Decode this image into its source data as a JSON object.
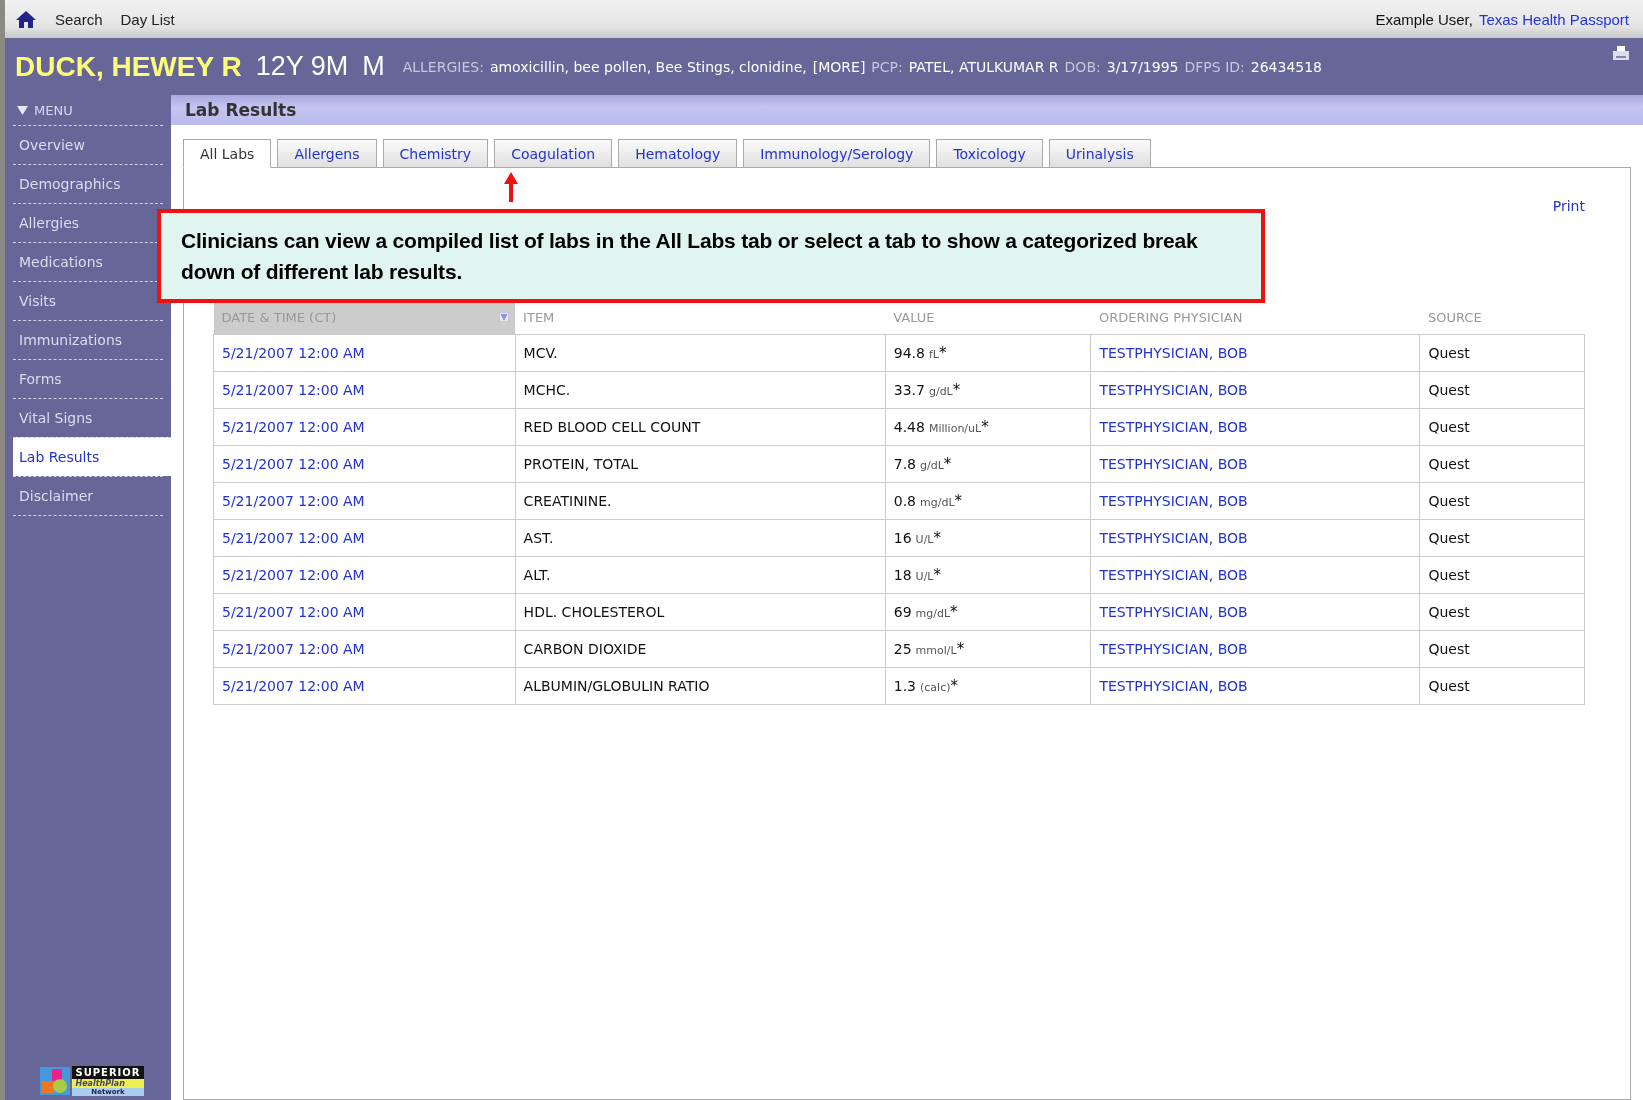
{
  "top_bar": {
    "links": [
      "Search",
      "Day List"
    ],
    "user": "Example User,",
    "organization": "Texas Health Passport"
  },
  "patient": {
    "name": "DUCK, HEWEY R",
    "age": "12Y 9M",
    "sex": "M",
    "fields": [
      {
        "label": "ALLERGIES:",
        "value": "amoxicillin, bee pollen, Bee Stings, clonidine,",
        "more": "[MORE]"
      },
      {
        "label": "PCP:",
        "value": "PATEL, ATULKUMAR R"
      },
      {
        "label": "DOB:",
        "value": "3/17/1995"
      },
      {
        "label": "DFPS ID:",
        "value": "26434518"
      }
    ]
  },
  "sidebar": {
    "menu_label": "MENU",
    "items": [
      {
        "label": "Overview",
        "selected": false
      },
      {
        "label": "Demographics",
        "selected": false
      },
      {
        "label": "Allergies",
        "selected": false
      },
      {
        "label": "Medications",
        "selected": false
      },
      {
        "label": "Visits",
        "selected": false
      },
      {
        "label": "Immunizations",
        "selected": false
      },
      {
        "label": "Forms",
        "selected": false
      },
      {
        "label": "Vital Signs",
        "selected": false
      },
      {
        "label": "Lab Results",
        "selected": true
      },
      {
        "label": "Disclaimer",
        "selected": false
      }
    ],
    "logo": {
      "name": "SUPERIOR",
      "tagline": "HealthPlan",
      "subtitle": "Network"
    }
  },
  "section_title": "Lab Results",
  "tabs": [
    {
      "label": "All Labs",
      "selected": true
    },
    {
      "label": "Allergens",
      "selected": false
    },
    {
      "label": "Chemistry",
      "selected": false
    },
    {
      "label": "Coagulation",
      "selected": false
    },
    {
      "label": "Hematology",
      "selected": false
    },
    {
      "label": "Immunology/Serology",
      "selected": false
    },
    {
      "label": "Toxicology",
      "selected": false
    },
    {
      "label": "Urinalysis",
      "selected": false
    }
  ],
  "print_link": "Print",
  "callout": "Clinicians can view a compiled list of labs in the All Labs tab or select a tab to show a categorized break down of different lab results.",
  "table": {
    "columns": [
      {
        "label": "DATE & TIME (CT)",
        "sorted": true
      },
      {
        "label": "ITEM",
        "sorted": false
      },
      {
        "label": "VALUE",
        "sorted": false
      },
      {
        "label": "ORDERING PHYSICIAN",
        "sorted": false
      },
      {
        "label": "SOURCE",
        "sorted": false
      }
    ],
    "rows": [
      {
        "date": "5/21/2007 12:00 AM",
        "item": "MCV.",
        "value": "94.8",
        "unit": "fL",
        "flag": "*",
        "physician": "TESTPHYSICIAN, BOB",
        "source": "Quest"
      },
      {
        "date": "5/21/2007 12:00 AM",
        "item": "MCHC.",
        "value": "33.7",
        "unit": "g/dL",
        "flag": "*",
        "physician": "TESTPHYSICIAN, BOB",
        "source": "Quest"
      },
      {
        "date": "5/21/2007 12:00 AM",
        "item": "RED BLOOD CELL COUNT",
        "value": "4.48",
        "unit": "Million/uL",
        "flag": "*",
        "physician": "TESTPHYSICIAN, BOB",
        "source": "Quest"
      },
      {
        "date": "5/21/2007 12:00 AM",
        "item": "PROTEIN, TOTAL",
        "value": "7.8",
        "unit": "g/dL",
        "flag": "*",
        "physician": "TESTPHYSICIAN, BOB",
        "source": "Quest"
      },
      {
        "date": "5/21/2007 12:00 AM",
        "item": "CREATININE.",
        "value": "0.8",
        "unit": "mg/dL",
        "flag": "*",
        "physician": "TESTPHYSICIAN, BOB",
        "source": "Quest"
      },
      {
        "date": "5/21/2007 12:00 AM",
        "item": "AST.",
        "value": "16",
        "unit": "U/L",
        "flag": "*",
        "physician": "TESTPHYSICIAN, BOB",
        "source": "Quest"
      },
      {
        "date": "5/21/2007 12:00 AM",
        "item": "ALT.",
        "value": "18",
        "unit": "U/L",
        "flag": "*",
        "physician": "TESTPHYSICIAN, BOB",
        "source": "Quest"
      },
      {
        "date": "5/21/2007 12:00 AM",
        "item": "HDL. CHOLESTEROL",
        "value": "69",
        "unit": "mg/dL",
        "flag": "*",
        "physician": "TESTPHYSICIAN, BOB",
        "source": "Quest"
      },
      {
        "date": "5/21/2007 12:00 AM",
        "item": "CARBON DIOXIDE",
        "value": "25",
        "unit": "mmol/L",
        "flag": "*",
        "physician": "TESTPHYSICIAN, BOB",
        "source": "Quest"
      },
      {
        "date": "5/21/2007 12:00 AM",
        "item": "ALBUMIN/GLOBULIN RATIO",
        "value": "1.3",
        "unit": "(calc)",
        "flag": "*",
        "physician": "TESTPHYSICIAN, BOB",
        "source": "Quest"
      }
    ]
  }
}
